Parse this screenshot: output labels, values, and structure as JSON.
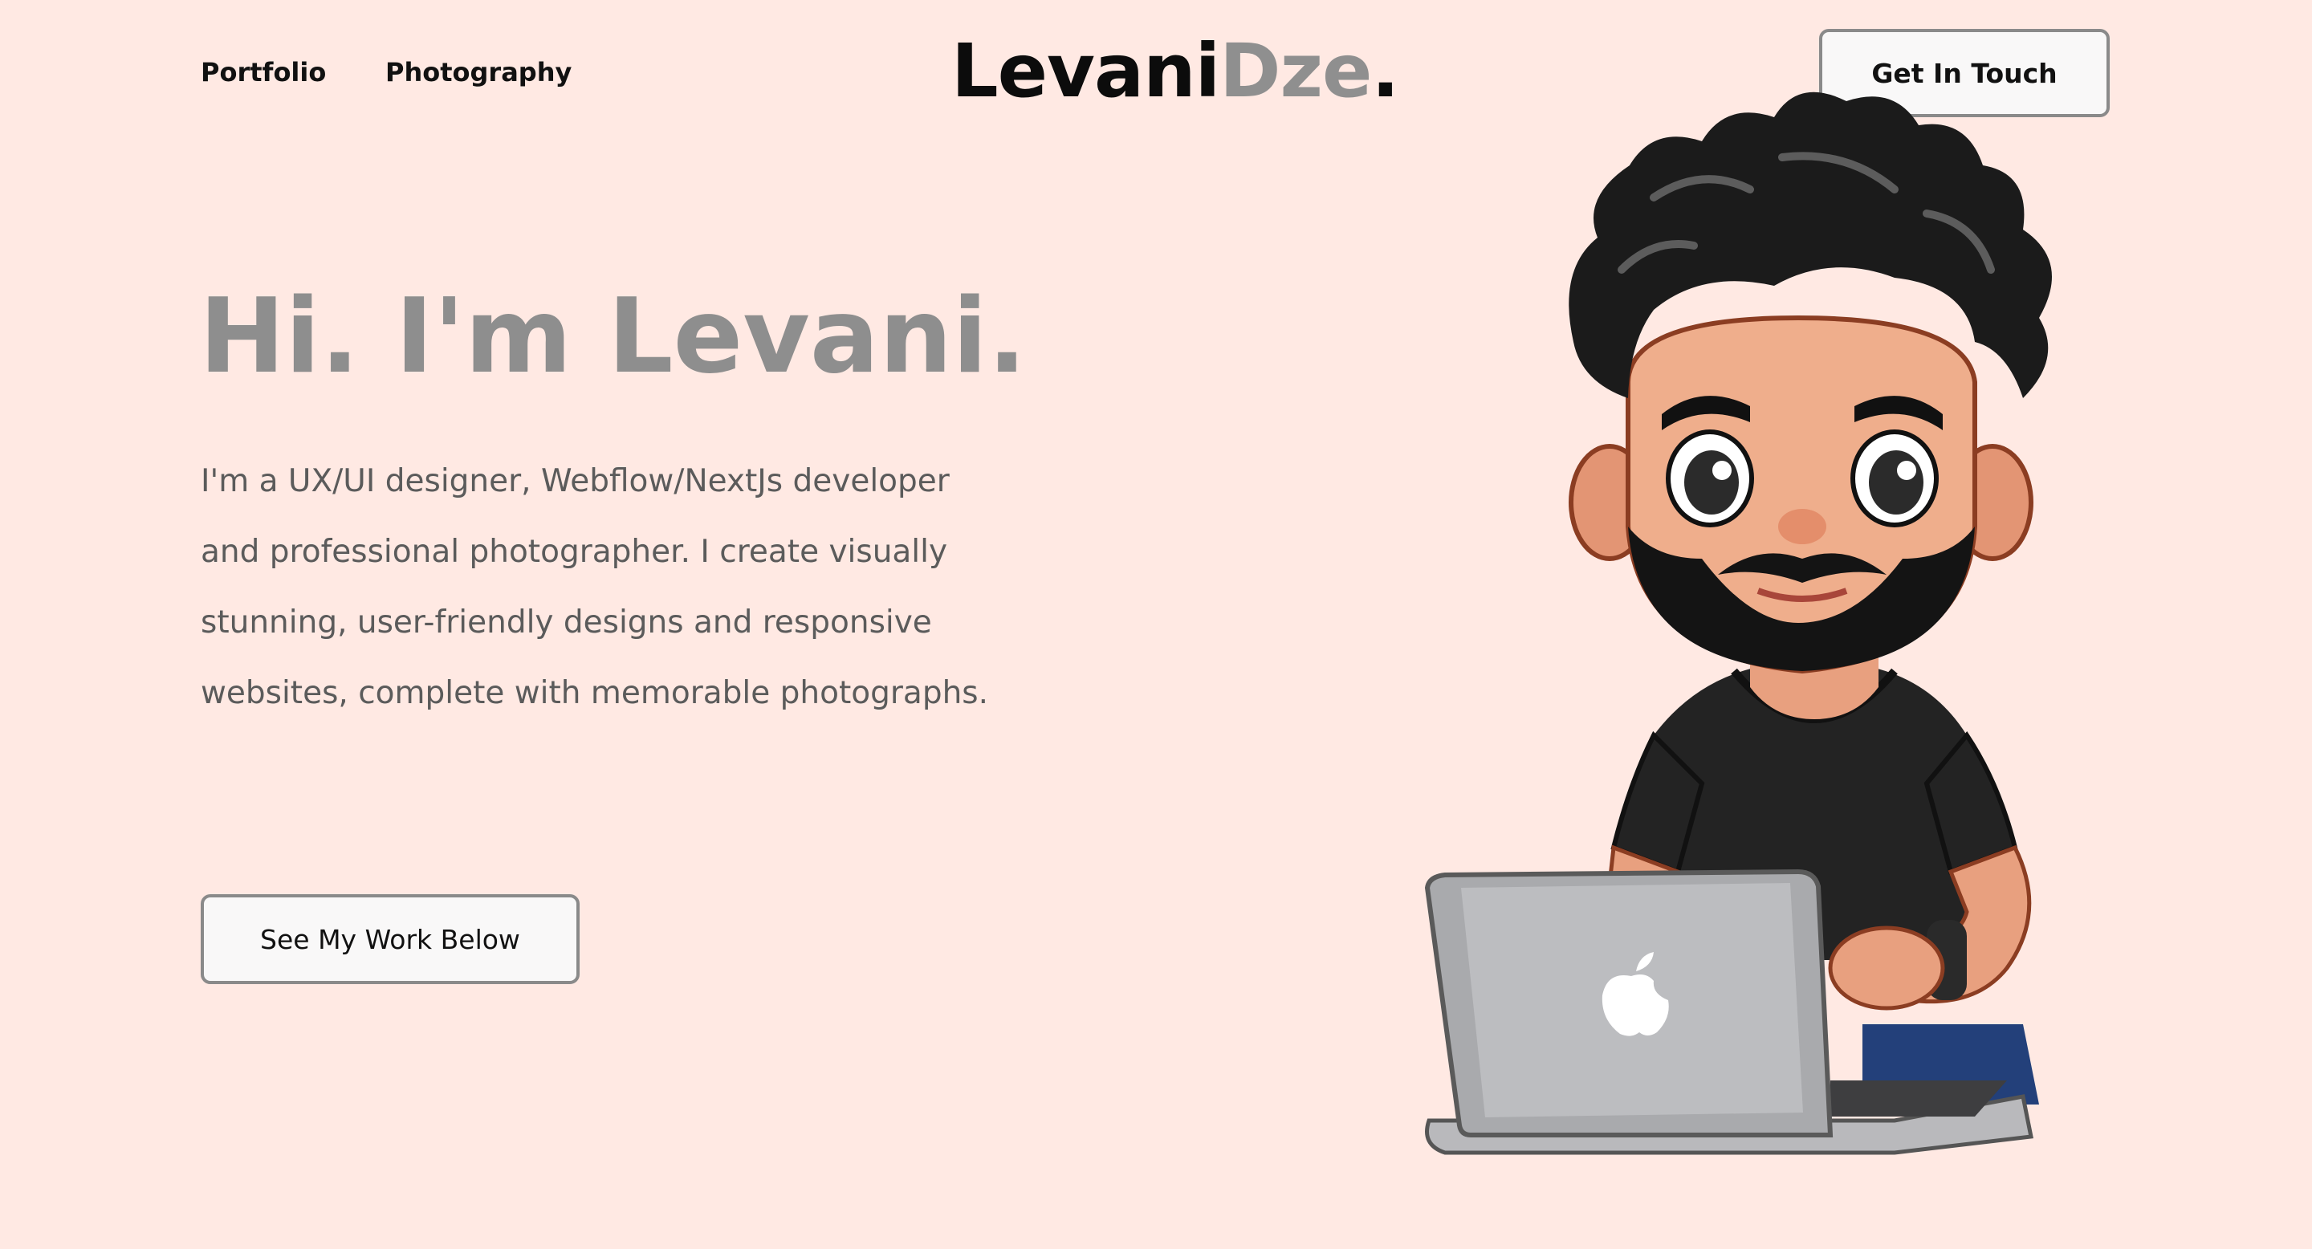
{
  "nav": {
    "portfolio": "Portfolio",
    "photography": "Photography",
    "cta": "Get In Touch"
  },
  "logo": {
    "part1": "Levani",
    "part2": "Dze",
    "dot": "."
  },
  "hero": {
    "title": "Hi. I'm Levani.",
    "description": "I'm a UX/UI designer, Webflow/NextJs developer and professional photographer. I create visually stunning, user-friendly designs and responsive websites, complete with memorable photographs.",
    "button": "See My Work Below"
  },
  "colors": {
    "background": "#FFE9E3",
    "title": "#8E8E8E",
    "body_text": "#5B5B5B",
    "button_bg": "#F9F8F8",
    "button_border": "#8A8A8A"
  },
  "illustration": {
    "icon": "developer-avatar-illustration"
  }
}
